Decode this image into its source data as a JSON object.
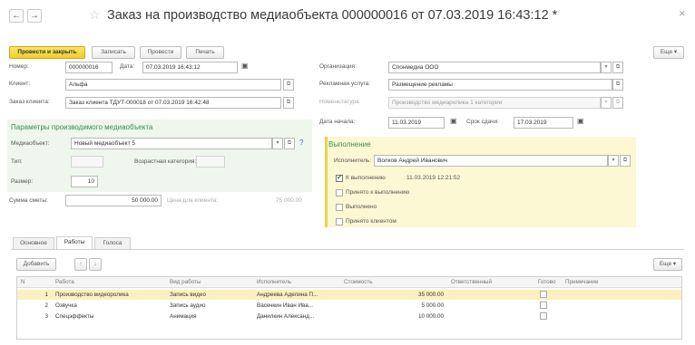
{
  "window": {
    "title": "Заказ на производство медиаобъекта 000000016 от 07.03.2019 16:43:12 *",
    "back_icon": "arrow-left",
    "forward_icon": "arrow-right",
    "star_icon": "star",
    "close_icon": "close"
  },
  "toolbar": {
    "post_close": "Провести и закрыть",
    "save": "Записать",
    "post": "Провести",
    "print": "Печать",
    "more": "Еще ▾"
  },
  "header": {
    "number_label": "Номер:",
    "number_value": "000000016",
    "date_label": "Дата:",
    "date_value": "07.03.2019 16:43:12",
    "client_label": "Клиент:",
    "client_value": "Альфа",
    "client_order_label": "Заказ клиента:",
    "client_order_value": "Заказ клиента ТДУТ-000018 от 07.03.2019 16:42:48",
    "org_label": "Организация:",
    "org_value": "Спонмедиа ООО",
    "ad_service_label": "Рекламная услуга:",
    "ad_service_value": "Размещение рекламы",
    "nomenclature_label": "Номенклатура:",
    "nomenclature_value": "Производство медиаролика 1 категории",
    "start_date_label": "Дата начала:",
    "start_date_value": "11.03.2019",
    "deadline_label": "Срок сдачи:",
    "deadline_value": "17.03.2019"
  },
  "media_params": {
    "title": "Параметры производимого медиаобъекта",
    "media_label": "Медиаобъект:",
    "media_value": "Новый медиаобъект 5",
    "help": "?",
    "type_label": "Тип:",
    "type_value": "",
    "age_label": "Возрастная категория:",
    "age_value": "",
    "size_label": "Размер:",
    "size_value": "10"
  },
  "estimate": {
    "sum_label": "Сумма сметы:",
    "sum_value": "50 000.00",
    "client_price_label": "Цена для клиента:",
    "client_price_value": "75 000.00"
  },
  "execution": {
    "title": "Выполнение",
    "executor_label": "Исполнитель:",
    "executor_value": "Волков Андрей Иванович",
    "checks": [
      {
        "label": "К выполнению",
        "checked": true,
        "extra": "11.03.2019 12:21:52"
      },
      {
        "label": "Принято к выполнению",
        "checked": false,
        "extra": ""
      },
      {
        "label": "Выполнено",
        "checked": false,
        "extra": ""
      },
      {
        "label": "Принято клиентом",
        "checked": false,
        "extra": ""
      }
    ]
  },
  "tabs": [
    "Основное",
    "Работы",
    "Голоса"
  ],
  "works": {
    "add": "Добавить",
    "up_icon": "arrow-up",
    "down_icon": "arrow-down",
    "more": "Еще ▾",
    "columns": [
      "N",
      "Работа",
      "Вид работы",
      "Исполнитель",
      "Стоимость",
      "Ответственный",
      "Готово",
      "Примечание"
    ],
    "rows": [
      {
        "n": "1",
        "work": "Производство видеоролика",
        "kind": "Запись видео",
        "executor": "Андреева Аделина П...",
        "cost": "35 000.00",
        "responsible": "",
        "done": false,
        "note": ""
      },
      {
        "n": "2",
        "work": "Озвучка",
        "kind": "Запись аудио",
        "executor": "Васечкин Иван Ива...",
        "cost": "5 000.00",
        "responsible": "",
        "done": false,
        "note": ""
      },
      {
        "n": "3",
        "work": "Спецэффекты",
        "kind": "Анимация",
        "executor": "Данилкин Александ...",
        "cost": "10 000.00",
        "responsible": "",
        "done": false,
        "note": ""
      }
    ]
  },
  "colors": {
    "primary_button": "#f3cd2a",
    "section_title": "#3a8f4f",
    "params_bg": "#eef6ee",
    "execution_bg": "#fbf8d3",
    "selected_row": "#fbf1c0"
  }
}
